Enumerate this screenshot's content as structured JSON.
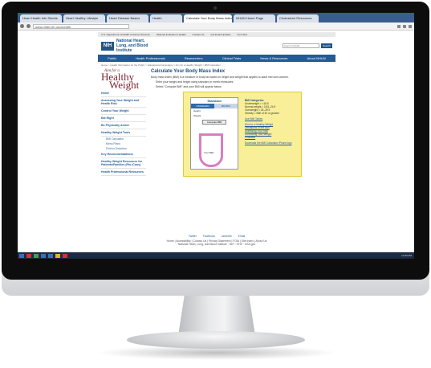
{
  "browser": {
    "tabs": [
      "Heart Health Info Sheets",
      "Heart Healthy Lifestyle",
      "Heart Disease Basics",
      "Health",
      "Calculate Your Body Mass Index",
      "NHLBI Home Page",
      "Cholesterol Resources",
      ""
    ],
    "url": "www.nhlbi.nih.gov/health"
  },
  "page": {
    "utility_links": [
      "U.S. Department of Health & Human Services",
      "National Institutes of Health",
      "Contact Us",
      "Get Email Updates",
      "Font Size"
    ],
    "org_name": "National Heart, Lung, and Blood Institute",
    "logo_text": "NIH",
    "search_placeholder": "Search NHLBI",
    "search_button": "Search",
    "nav": [
      "Public",
      "Health Professionals",
      "Researchers",
      "Clinical Trials",
      "News & Resources",
      "About NHLBI"
    ],
    "breadcrumb": "Home > Health Information for the Public > Educational Campaigns > Aim for a Healthy Weight > BMI Calculator",
    "side_logo": {
      "small": "Aim for a",
      "big1": "Healthy",
      "big2": "Weight"
    },
    "side_items": [
      "Home",
      "Assessing Your Weight and Health Risk",
      "Control Your Weight",
      "Eat Right",
      "Be Physically Active",
      "Healthy Weight Tools"
    ],
    "side_subitems": [
      "BMI Calculator",
      "Menu Plans",
      "Portion Distortion"
    ],
    "side_items2": [
      "Key Recommendations",
      "Healthy Weight Resources for Patients/Families (Pts./Cons)",
      "Health Professional Resources"
    ],
    "heading": "Calculate Your Body Mass Index",
    "intro": "Body mass index (BMI) is a measure of body fat based on height and weight that applies to adult men and women.",
    "bullets": [
      "Enter your weight and height using standard or metric measures.",
      "Select \"Compute BMI\" and your BMI will appear below."
    ],
    "calc": {
      "title": "Standard",
      "tab_standard": "STANDARD",
      "tab_metric": "METRIC",
      "height_label": "Height",
      "weight_label": "Weight",
      "compute_button": "Compute BMI",
      "your_bmi": "Your BMI"
    },
    "bmi_categories": {
      "title": "BMI Categories:",
      "lines": [
        "Underweight = <18.5",
        "Normal weight = 18.5–24.9",
        "Overweight = 25–29.9",
        "Obesity = BMI of 30 or greater"
      ],
      "link1": "Use BMI Tables",
      "link2": "Aim for a Healthy Weight",
      "link2_lines": [
        "Limitations of the BMI",
        "Assessing Your Risk",
        "Controlling Your Weight",
        "Podcasts"
      ],
      "download": "Download the BMI Calculator iPhone App"
    },
    "footer": {
      "social": [
        "Twitter",
        "Facebook",
        "LinkedIn",
        "Email"
      ],
      "links": "Home | Accessibility | Contact Us | Privacy Statement | FOIA | Site Index | About Us",
      "sub": "National Heart, Lung, and Blood Institute · NIH · HHS · USA.gov"
    }
  },
  "taskbar": {
    "clock": "12:39 PM"
  }
}
